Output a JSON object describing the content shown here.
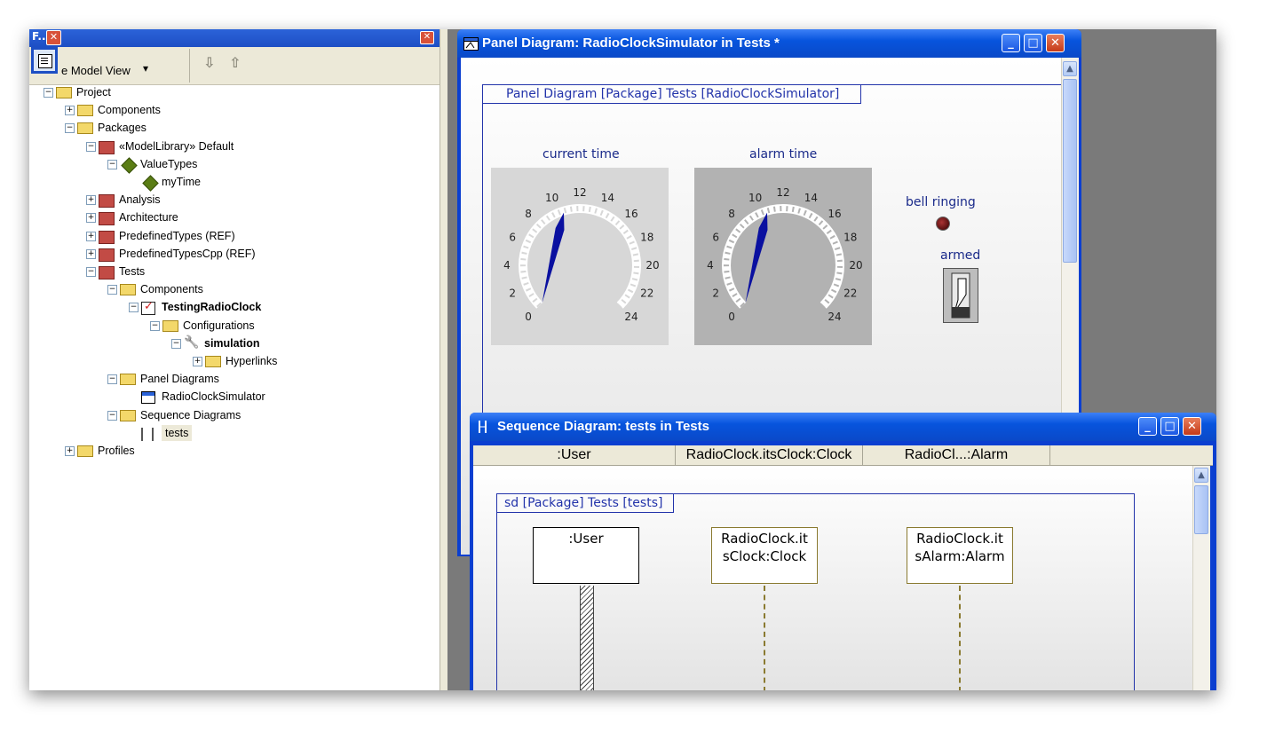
{
  "browser": {
    "title": "F..",
    "view_label": "e Model View",
    "view_dropdown": "▾",
    "nav_back": "⇩",
    "nav_up": "⇧",
    "tree": [
      {
        "label": "Project",
        "level": 0,
        "icon": "folder",
        "expanded": true
      },
      {
        "label": "Components",
        "level": 1,
        "icon": "folder",
        "expanded": false
      },
      {
        "label": "Packages",
        "level": 1,
        "icon": "folder",
        "expanded": true
      },
      {
        "label": "«ModelLibrary» Default",
        "level": 2,
        "icon": "package",
        "expanded": true
      },
      {
        "label": "ValueTypes",
        "level": 3,
        "icon": "type",
        "expanded": true
      },
      {
        "label": "myTime",
        "level": 4,
        "icon": "type"
      },
      {
        "label": "Analysis",
        "level": 2,
        "icon": "package",
        "expanded": false
      },
      {
        "label": "Architecture",
        "level": 2,
        "icon": "package",
        "expanded": false
      },
      {
        "label": "PredefinedTypes (REF)",
        "level": 2,
        "icon": "package",
        "expanded": false
      },
      {
        "label": "PredefinedTypesCpp (REF)",
        "level": 2,
        "icon": "package",
        "expanded": false
      },
      {
        "label": "Tests",
        "level": 2,
        "icon": "package",
        "expanded": true
      },
      {
        "label": "Components",
        "level": 3,
        "icon": "folder",
        "expanded": true
      },
      {
        "label": "TestingRadioClock",
        "level": 4,
        "icon": "component",
        "expanded": true,
        "bold": true
      },
      {
        "label": "Configurations",
        "level": 5,
        "icon": "folder",
        "expanded": true
      },
      {
        "label": "simulation",
        "level": 6,
        "icon": "wrench",
        "expanded": true,
        "bold": true
      },
      {
        "label": "Hyperlinks",
        "level": 7,
        "icon": "folder",
        "expanded": false
      },
      {
        "label": "Panel Diagrams",
        "level": 3,
        "icon": "folder",
        "expanded": true
      },
      {
        "label": "RadioClockSimulator",
        "level": 4,
        "icon": "panel-diagram"
      },
      {
        "label": "Sequence Diagrams",
        "level": 3,
        "icon": "folder",
        "expanded": true
      },
      {
        "label": "tests",
        "level": 4,
        "icon": "sequence-diagram",
        "selected": true
      },
      {
        "label": "Profiles",
        "level": 1,
        "icon": "folder",
        "expanded": false
      }
    ]
  },
  "panel_window": {
    "title": "Panel Diagram: RadioClockSimulator in Tests *",
    "frame_label": "Panel Diagram [Package] Tests [RadioClockSimulator]",
    "gauges": [
      {
        "label": "current time",
        "ticks": [
          "0",
          "2",
          "4",
          "6",
          "8",
          "10",
          "12",
          "14",
          "16",
          "18",
          "20",
          "22",
          "24"
        ],
        "value": 10.5
      },
      {
        "label": "alarm time",
        "ticks": [
          "0",
          "2",
          "4",
          "6",
          "8",
          "10",
          "12",
          "14",
          "16",
          "18",
          "20",
          "22",
          "24"
        ],
        "value": 10.5
      }
    ],
    "led_label": "bell ringing",
    "switch_label": "armed",
    "buttons": {
      "minimize": "_",
      "maximize": "□",
      "close": "✕"
    }
  },
  "sequence_window": {
    "title": "Sequence Diagram: tests in Tests",
    "header_cells": [
      ":User",
      "RadioClock.itsClock:Clock",
      "RadioCl...:Alarm"
    ],
    "frame_label": "sd [Package] Tests [tests]",
    "lifelines": [
      {
        "line1": ":User",
        "line2": ""
      },
      {
        "line1": "RadioClock.it",
        "line2": "sClock:Clock"
      },
      {
        "line1": "RadioClock.it",
        "line2": "sAlarm:Alarm"
      }
    ],
    "buttons": {
      "minimize": "_",
      "maximize": "□",
      "close": "✕"
    }
  },
  "colors": {
    "xp_blue": "#0754dd",
    "diagram_blue": "#2233aa",
    "gauge_needle": "#0a10a0",
    "gauge_face_1": "#d7d7d7",
    "gauge_face_2": "#b2b2b2",
    "lifeline_border": "#8a7a30"
  }
}
